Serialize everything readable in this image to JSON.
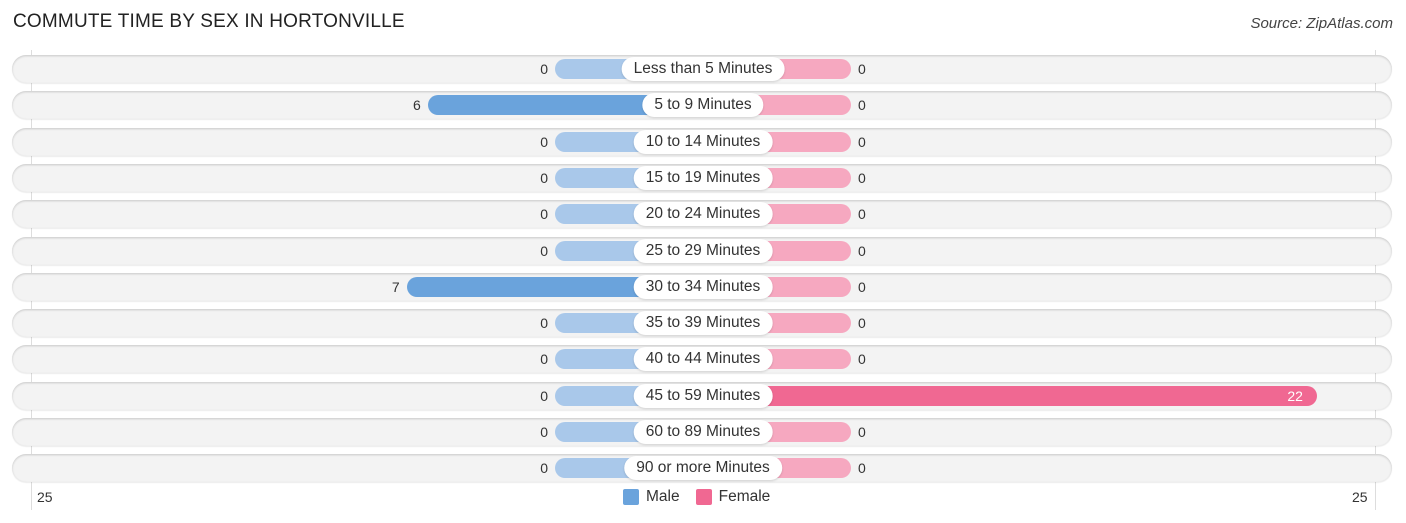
{
  "title": "COMMUTE TIME BY SEX IN HORTONVILLE",
  "source": "Source: ZipAtlas.com",
  "colors": {
    "male": "#6aa3dc",
    "male_light": "#a9c8ea",
    "female": "#f06892",
    "female_light": "#f6a8c0"
  },
  "chart_data": {
    "type": "bar",
    "orientation": "horizontal-diverging",
    "title": "COMMUTE TIME BY SEX IN HORTONVILLE",
    "categories": [
      "Less than 5 Minutes",
      "5 to 9 Minutes",
      "10 to 14 Minutes",
      "15 to 19 Minutes",
      "20 to 24 Minutes",
      "25 to 29 Minutes",
      "30 to 34 Minutes",
      "35 to 39 Minutes",
      "40 to 44 Minutes",
      "45 to 59 Minutes",
      "60 to 89 Minutes",
      "90 or more Minutes"
    ],
    "series": [
      {
        "name": "Male",
        "values": [
          0,
          6,
          0,
          0,
          0,
          0,
          7,
          0,
          0,
          0,
          0,
          0
        ]
      },
      {
        "name": "Female",
        "values": [
          0,
          0,
          0,
          0,
          0,
          0,
          0,
          0,
          0,
          22,
          0,
          0
        ]
      }
    ],
    "axis": {
      "left_tick": "25",
      "right_tick": "25",
      "range": [
        25,
        25
      ]
    },
    "legend": {
      "position": "bottom-center",
      "entries": [
        "Male",
        "Female"
      ]
    }
  }
}
